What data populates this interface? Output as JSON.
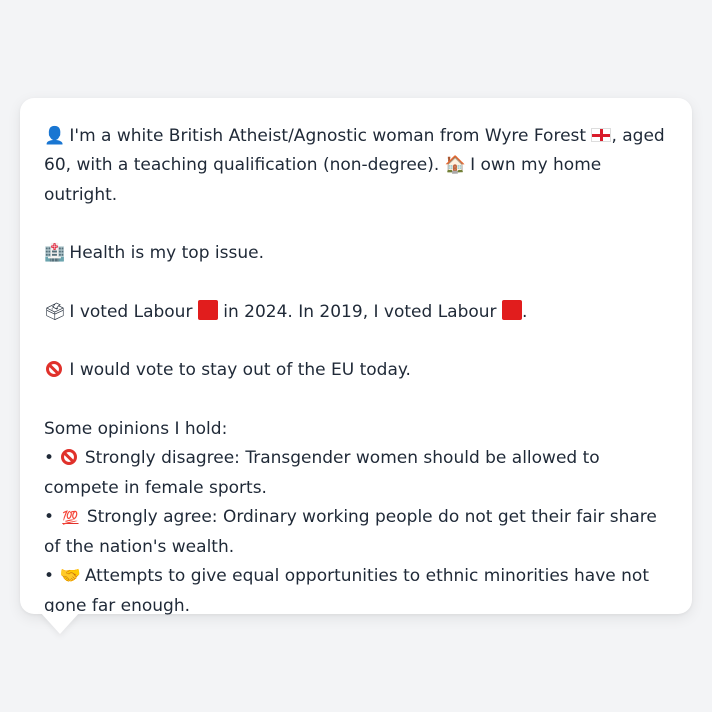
{
  "message": {
    "line1_a": "I'm a white British Atheist/Agnostic woman from Wyre Forest",
    "line1_b": ", aged 60, with a teaching qualification (non-degree).",
    "line1_c": "I own my home outright.",
    "line2": "Health is my top issue.",
    "line3_a": "I voted Labour",
    "line3_b": "in 2024. In 2019, I voted Labour",
    "line3_c": ".",
    "line4": "I would vote to stay out of the EU today.",
    "opinions_heading": "Some opinions I hold:",
    "bullet": "•",
    "opinions": [
      "Strongly disagree: Transgender women should be allowed to compete in female sports.",
      "Strongly agree: Ordinary working people do not get their fair share of the nation's wealth.",
      "Attempts to give equal opportunities to ethnic minorities have not gone far enough."
    ]
  },
  "icons": {
    "person": "👤",
    "house": "🏠",
    "hospital": "🏥",
    "ballot": "🗳",
    "hundred": "💯",
    "handshake": "🤝",
    "flag_color": "#d91c2b",
    "party_color": "#e11d1d"
  }
}
